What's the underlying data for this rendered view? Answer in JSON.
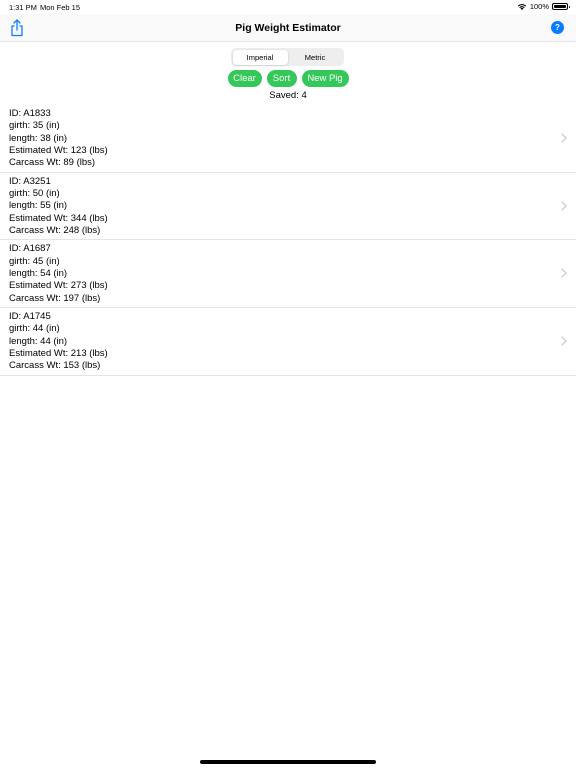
{
  "status_bar": {
    "time": "1:31 PM",
    "date": "Mon Feb 15",
    "battery": "100%"
  },
  "nav": {
    "title": "Pig Weight Estimator",
    "help_label": "?"
  },
  "units": {
    "options": [
      "Imperial",
      "Metric"
    ],
    "selected": "Imperial"
  },
  "buttons": {
    "clear": "Clear",
    "sort": "Sort",
    "new_pig": "New Pig"
  },
  "saved_text": "Saved: 4",
  "pigs": [
    {
      "id": "ID: A1833",
      "girth": "girth: 35 (in)",
      "length": "length: 38 (in)",
      "estimated": "Estimated Wt: 123 (lbs)",
      "carcass": "Carcass Wt: 89 (lbs)"
    },
    {
      "id": "ID: A3251",
      "girth": "girth: 50 (in)",
      "length": "length: 55 (in)",
      "estimated": "Estimated Wt: 344 (lbs)",
      "carcass": "Carcass Wt: 248 (lbs)"
    },
    {
      "id": "ID: A1687",
      "girth": "girth: 45 (in)",
      "length": "length: 54 (in)",
      "estimated": "Estimated Wt: 273 (lbs)",
      "carcass": "Carcass Wt: 197 (lbs)"
    },
    {
      "id": "ID: A1745",
      "girth": "girth: 44 (in)",
      "length": "length: 44 (in)",
      "estimated": "Estimated Wt: 213 (lbs)",
      "carcass": "Carcass Wt: 153 (lbs)"
    }
  ],
  "colors": {
    "accent": "#34c759",
    "help": "#0a7cff"
  }
}
